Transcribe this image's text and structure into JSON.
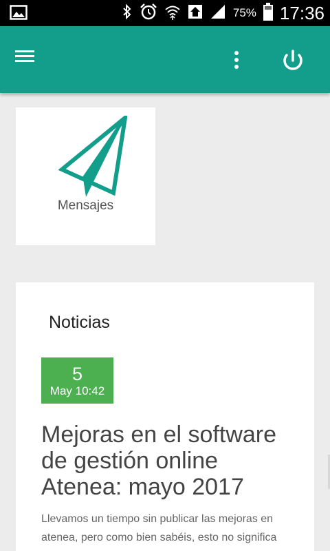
{
  "status_bar": {
    "battery_percent": "75%",
    "time": "17:36",
    "icons": [
      "gallery-icon",
      "bluetooth-icon",
      "alarm-icon",
      "wifi-icon",
      "home-icon",
      "signal-icon",
      "battery-icon"
    ]
  },
  "app_bar": {
    "color": "#139e8c",
    "icons": [
      "menu-icon",
      "more-vert-icon",
      "power-icon"
    ]
  },
  "tiles": [
    {
      "label": "Mensajes",
      "icon": "paper-plane-icon"
    }
  ],
  "news": {
    "heading": "Noticias",
    "items": [
      {
        "day": "5",
        "date_time": "May 10:42",
        "badge_color": "#4caf50",
        "title": "Mejoras en el software de gestión online Atenea: mayo 2017",
        "excerpt": "Llevamos un tiempo sin publicar las mejoras en atenea, pero como bien sabéis, esto no significa"
      }
    ]
  }
}
